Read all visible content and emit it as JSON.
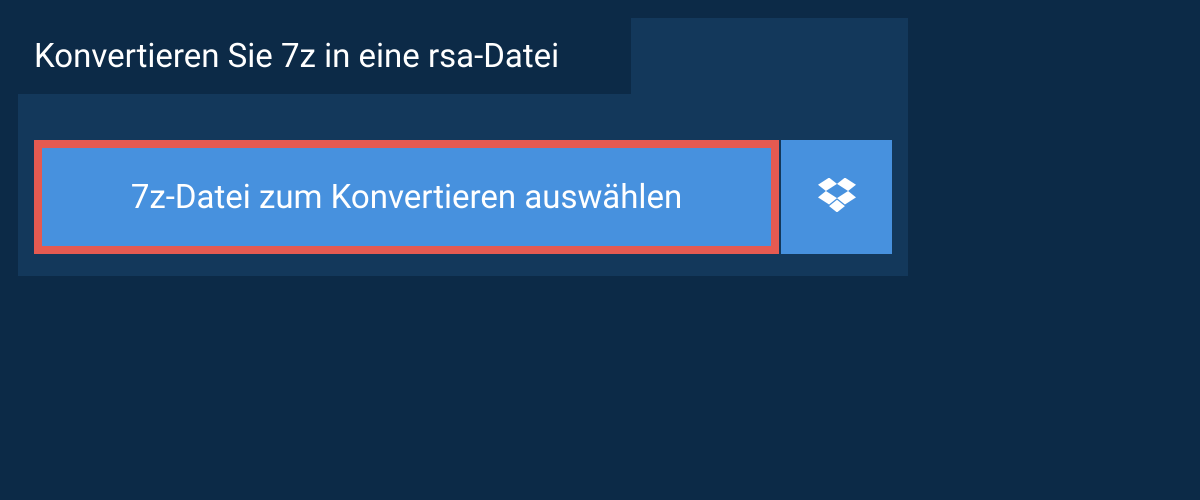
{
  "header": {
    "title": "Konvertieren Sie 7z in eine rsa-Datei"
  },
  "actions": {
    "select_file_label": "7z-Datei zum Konvertieren auswählen",
    "dropbox_icon_name": "dropbox-icon"
  },
  "colors": {
    "background": "#0c2a47",
    "panel": "#13385b",
    "button": "#4791de",
    "highlight_border": "#e55a51",
    "text": "#ffffff"
  }
}
